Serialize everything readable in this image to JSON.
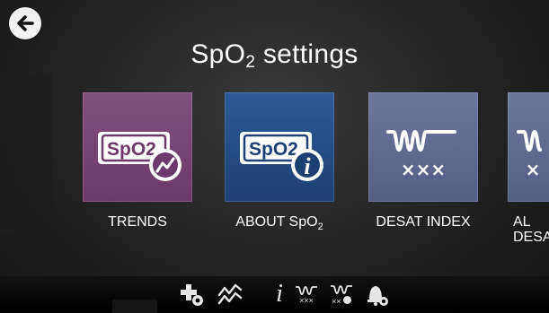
{
  "header": {
    "title_main": "SpO",
    "title_sub": "2",
    "title_rest": " settings"
  },
  "tiles": [
    {
      "label": "TRENDS",
      "icon": "spo2-trends-icon",
      "badge": "SpO2"
    },
    {
      "label_main": "ABOUT SpO",
      "label_sub": "2",
      "icon": "spo2-info-icon",
      "badge": "SpO2"
    },
    {
      "label": "DESAT INDEX",
      "icon": "desat-index-icon",
      "marks": "×××"
    },
    {
      "label_line1": "AL",
      "label_line2": "DESA",
      "icon": "alarm-desat-icon",
      "marks": "×"
    }
  ],
  "toolbar": {
    "items": [
      "add-settings-icon",
      "trends-icon",
      "info-icon",
      "desat-index-icon",
      "desat-info-icon",
      "alarm-settings-icon"
    ],
    "info_glyph": "i",
    "desat_marks": "×××",
    "desat_info_marks": "××"
  },
  "colors": {
    "trends_tile": "#6b3a6a",
    "about_tile": "#1d3f74",
    "desat_tile": "#555f84"
  }
}
